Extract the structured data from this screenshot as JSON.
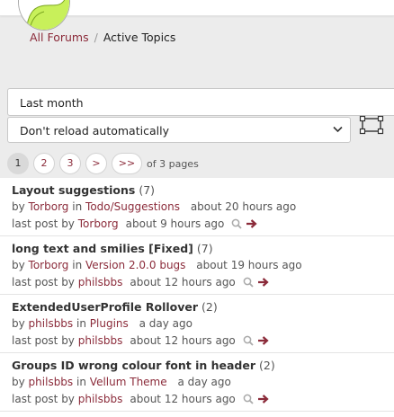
{
  "breadcrumb": {
    "forums_link": "All Forums",
    "separator": "/",
    "current": "Active Topics"
  },
  "filters": {
    "time_range": "Last month",
    "reload": "Don't reload automatically"
  },
  "pagination": {
    "pages": [
      {
        "label": "1"
      },
      {
        "label": "2"
      },
      {
        "label": "3"
      },
      {
        "label": ">"
      },
      {
        "label": ">>"
      }
    ],
    "current_page": 1,
    "info": "of 3 pages"
  },
  "topics": [
    {
      "title": "Layout suggestions",
      "count": "(7)",
      "by_label": "by",
      "author": "Torborg",
      "in_label": "in",
      "forum": "Todo/Suggestions",
      "started": "about 20 hours ago",
      "last_post_label": "last post by",
      "last_author": "Torborg",
      "last_time": "about 9 hours ago"
    },
    {
      "title": "long text and smilies [Fixed]",
      "count": "(7)",
      "by_label": "by",
      "author": "Torborg",
      "in_label": "in",
      "forum": "Version 2.0.0 bugs",
      "started": "about 19 hours ago",
      "last_post_label": "last post by",
      "last_author": "philsbbs",
      "last_time": "about 12 hours ago"
    },
    {
      "title": "ExtendedUserProfile Rollover",
      "count": "(2)",
      "by_label": "by",
      "author": "philsbbs",
      "in_label": "in",
      "forum": "Plugins",
      "started": "a day ago",
      "last_post_label": "last post by",
      "last_author": "philsbbs",
      "last_time": "about 12 hours ago"
    },
    {
      "title": "Groups ID wrong colour font in header",
      "count": "(2)",
      "by_label": "by",
      "author": "philsbbs",
      "in_label": "in",
      "forum": "Vellum Theme",
      "started": "a day ago",
      "last_post_label": "last post by",
      "last_author": "philsbbs",
      "last_time": "about 12 hours ago"
    }
  ],
  "icons": {
    "avatar": "avatar-image",
    "expand": "expand-icon",
    "magnifier": "magnifier-icon",
    "goto": "arrow-right-icon",
    "dropdown": "chevron-down-icon"
  },
  "colors": {
    "link": "#8b2b3a",
    "band": "#ececec",
    "avatar_green": "#c8f05a"
  }
}
